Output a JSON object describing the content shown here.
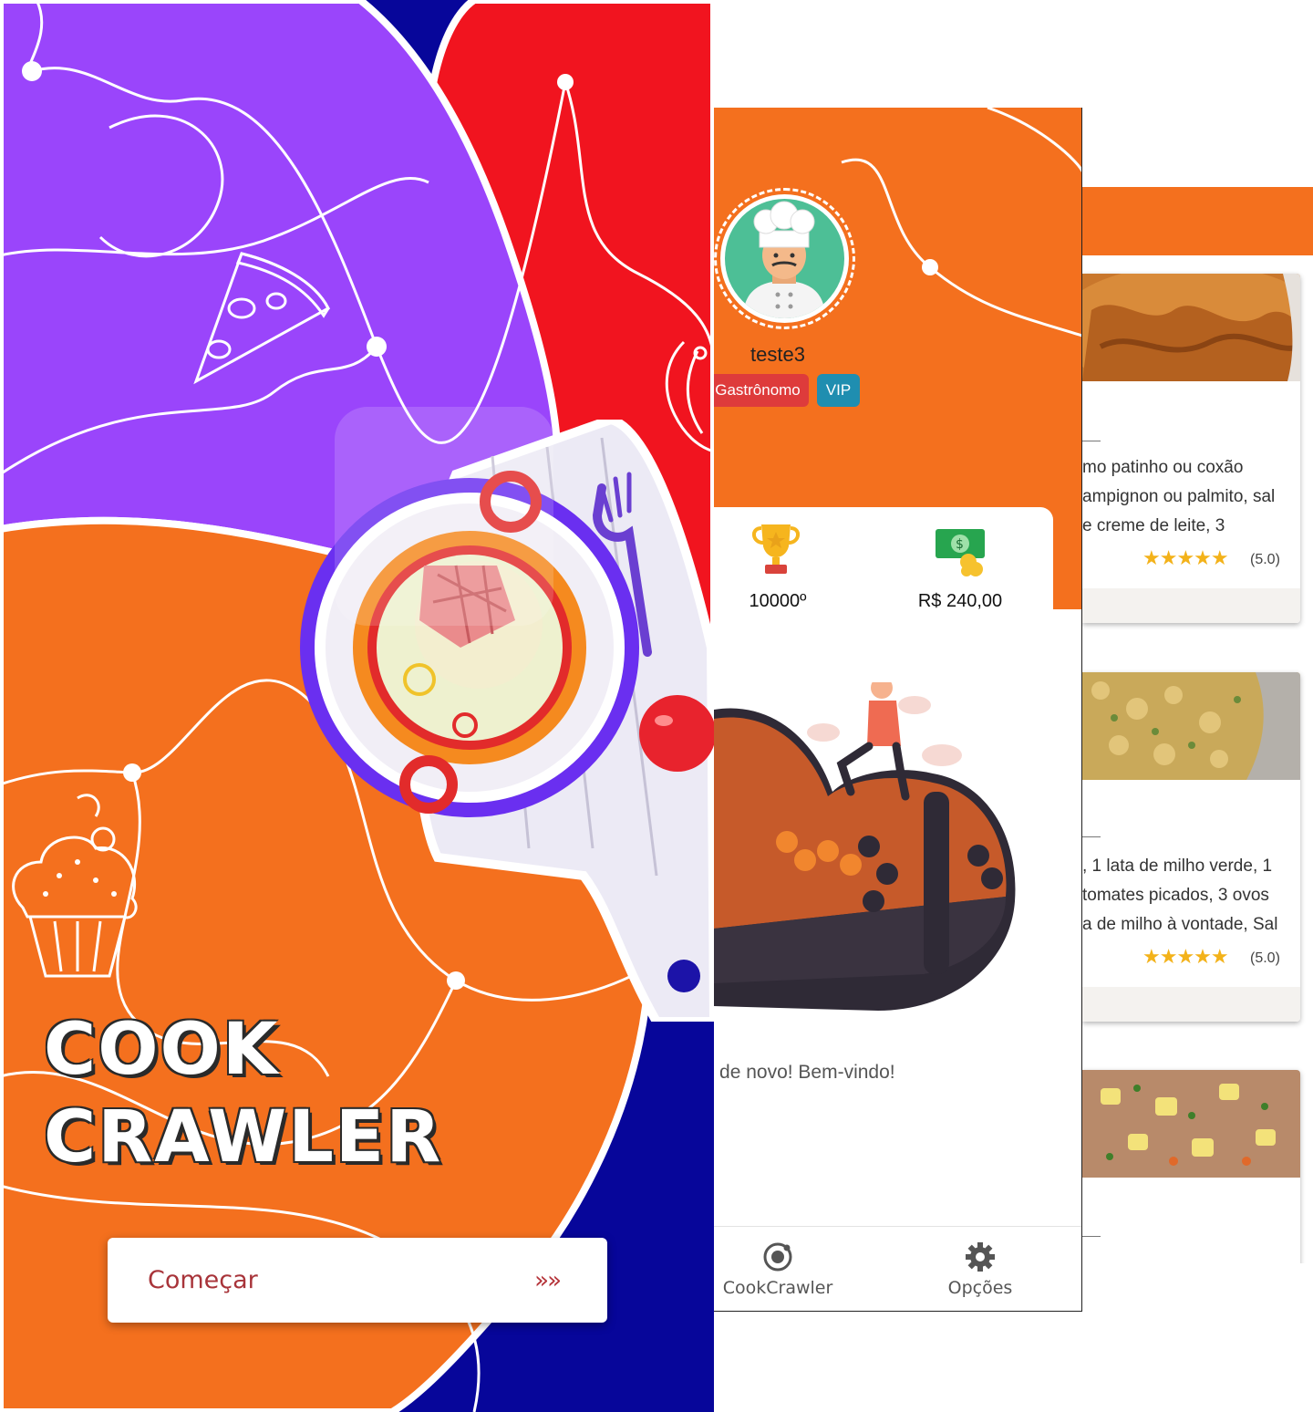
{
  "splash": {
    "title_line1": "COOK",
    "title_line2": "CRAWLER",
    "start_button": {
      "label": "Começar",
      "arrows": "»»"
    },
    "colors": {
      "purple": "#9a45fb",
      "red": "#f1141f",
      "orange": "#f4701e",
      "navy": "#07069a"
    },
    "icons": [
      "pizza-icon",
      "cupcake-icon",
      "soup-bowl-icon",
      "fork-icon",
      "apple-icon",
      "sandwich-icon"
    ]
  },
  "profile": {
    "username": "teste3",
    "badges": {
      "rank": "Gastrônomo",
      "vip": "VIP"
    },
    "stats": {
      "ranking": "10000º",
      "balance": "R$ 240,00"
    },
    "welcome": "cê de novo! Bem-vindo!",
    "tabs": [
      {
        "label": "CookCrawler",
        "icon": "ionic-icon"
      },
      {
        "label": "Opções",
        "icon": "gear-icon"
      }
    ],
    "colors": {
      "header": "#f4701e",
      "avatar_bg": "#4dbf96",
      "rank_badge": "#de3b3b",
      "vip_badge": "#1f8eb0"
    }
  },
  "recipes": {
    "cards": [
      {
        "lines": [
          "mo patinho ou coxão",
          "ampignon ou palmito, sal",
          "e creme de leite, 3"
        ],
        "stars": "★★★★★",
        "rating": "(5.0)"
      },
      {
        "lines": [
          ", 1 lata de milho verde, 1",
          "tomates picados, 3 ovos",
          "a de milho à vontade, Sal"
        ],
        "stars": "★★★★★",
        "rating": "(5.0)"
      },
      {
        "lines": [],
        "stars": "",
        "rating": ""
      }
    ]
  }
}
